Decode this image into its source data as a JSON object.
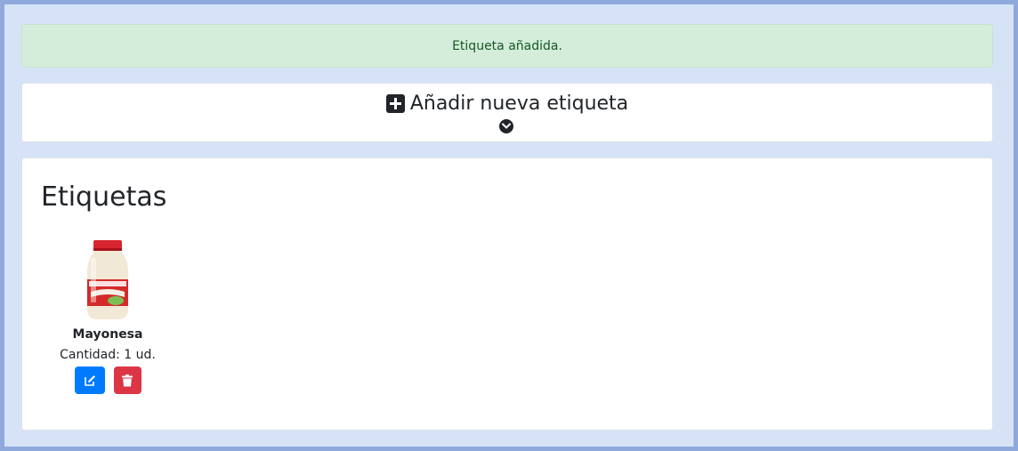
{
  "alert": {
    "message": "Etiqueta añadida."
  },
  "add_panel": {
    "title": "Añadir nueva etiqueta"
  },
  "list": {
    "title": "Etiquetas",
    "items": [
      {
        "name": "Mayonesa",
        "quantity_text": "Cantidad: 1 ud."
      }
    ]
  },
  "colors": {
    "alert_bg": "#d4edda",
    "alert_text": "#155724",
    "edit_button": "#007bff",
    "delete_button": "#dc3545",
    "frame_bg": "#d6e3f7",
    "frame_border": "#8fa9dc"
  },
  "icons": {
    "add": "plus-square-icon",
    "expand": "chevron-down-circle-icon",
    "edit": "edit-icon",
    "delete": "trash-icon",
    "product": "mayonnaise-jar-image"
  }
}
